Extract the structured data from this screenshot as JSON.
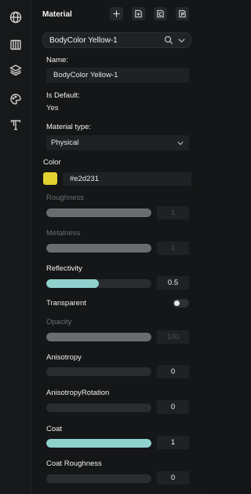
{
  "rail": {
    "icons": [
      "globe-icon",
      "texture-icon",
      "layers-icon",
      "palette-icon",
      "typography-icon"
    ]
  },
  "header": {
    "title": "Material",
    "buttons": [
      "add-icon",
      "new-material-icon",
      "copy-material-icon",
      "paste-material-icon"
    ]
  },
  "selector": {
    "value": "BodyColor Yellow-1"
  },
  "fields": {
    "name_label": "Name:",
    "name_value": "BodyColor Yellow-1",
    "is_default_label": "Is Default:",
    "is_default_value": "Yes",
    "material_type_label": "Material type:",
    "material_type_value": "Physical",
    "color_label": "Color",
    "color_hex": "#e2d231",
    "transparent_label": "Transparent",
    "transparent_on": false
  },
  "colors": {
    "swatch": "#e2d231",
    "slider_active": "#8fd1cd",
    "slider_disabled": "#6a6d70"
  },
  "sliders": [
    {
      "label": "Roughness",
      "value": "1",
      "fraction": 1.0,
      "enabled": false
    },
    {
      "label": "Metalness",
      "value": "1",
      "fraction": 1.0,
      "enabled": false
    },
    {
      "label": "Reflectivity",
      "value": "0.5",
      "fraction": 0.5,
      "enabled": true
    },
    {
      "label": "Opacity",
      "value": "100",
      "fraction": 1.0,
      "enabled": false
    },
    {
      "label": "Anisotropy",
      "value": "0",
      "fraction": 0.0,
      "enabled": true
    },
    {
      "label": "AnisotropyRotation",
      "value": "0",
      "fraction": 0.0,
      "enabled": true
    },
    {
      "label": "Coat",
      "value": "1",
      "fraction": 1.0,
      "enabled": true
    },
    {
      "label": "Coat Roughness",
      "value": "0",
      "fraction": 0.0,
      "enabled": true
    }
  ]
}
